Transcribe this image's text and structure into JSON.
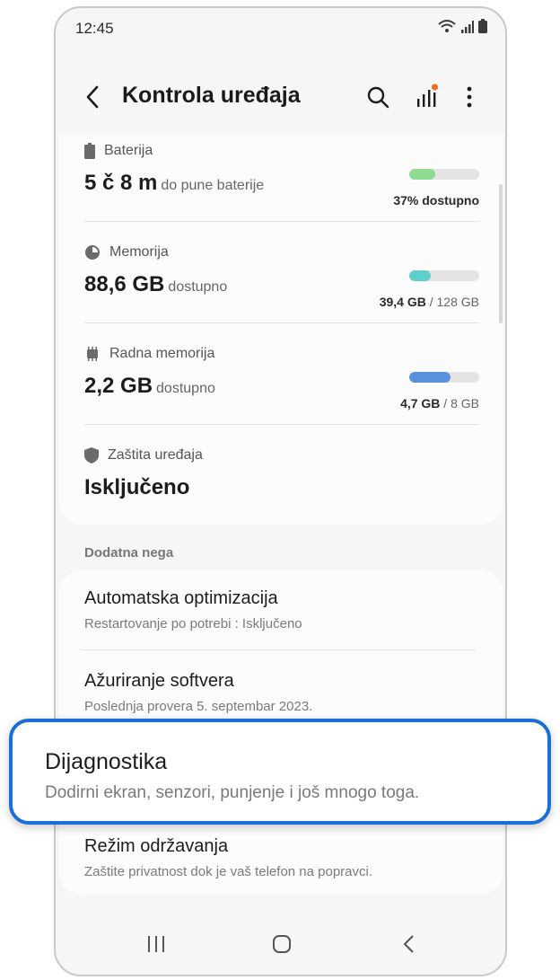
{
  "status_bar": {
    "time": "12:45"
  },
  "app_bar": {
    "title": "Kontrola uređaja",
    "icons": [
      "back-arrow-icon",
      "search-icon",
      "signal-bars-icon",
      "more-vert-icon"
    ]
  },
  "status_cards": [
    {
      "label": "Baterija",
      "icon": "battery-icon",
      "value": "5 č 8 m",
      "suffix": "do pune baterije",
      "usage_main": "37% dostupno",
      "usage_rest": "",
      "fill": 0.37,
      "color": "#8fdc91"
    },
    {
      "label": "Memorija",
      "icon": "pie-chart-icon",
      "value": "88,6 GB",
      "suffix": "dostupno",
      "usage_main": "39,4 GB",
      "usage_rest": " / 128 GB",
      "fill": 0.31,
      "color": "#5fcfce"
    },
    {
      "label": "Radna memorija",
      "icon": "memory-chip-icon",
      "value": "2,2 GB",
      "suffix": "dostupno",
      "usage_main": "4,7 GB",
      "usage_rest": " / 8 GB",
      "fill": 0.59,
      "color": "#5b90db"
    },
    {
      "label": "Zaštita uređaja",
      "icon": "shield-icon",
      "value": "Isključeno"
    }
  ],
  "section_header": "Dodatna nega",
  "care_items": [
    {
      "title": "Automatska optimizacija",
      "subtitle": "Restartovanje po potrebi : Isključeno"
    },
    {
      "title": "Ažuriranje softvera",
      "subtitle": "Poslednja provera 5. septembar 2023."
    },
    {
      "title": "Režim održavanja",
      "subtitle": "Zaštite privatnost dok je vaš telefon na popravci."
    }
  ],
  "highlighted_item": {
    "title": "Dijagnostika",
    "subtitle": "Dodirni ekran, senzori, punjenje i još mnogo toga."
  },
  "colors": {
    "accent": "#1a6fd8",
    "notification_dot": "#f26b1d"
  },
  "nav_bar": [
    "recents-icon",
    "home-icon",
    "back-icon"
  ]
}
